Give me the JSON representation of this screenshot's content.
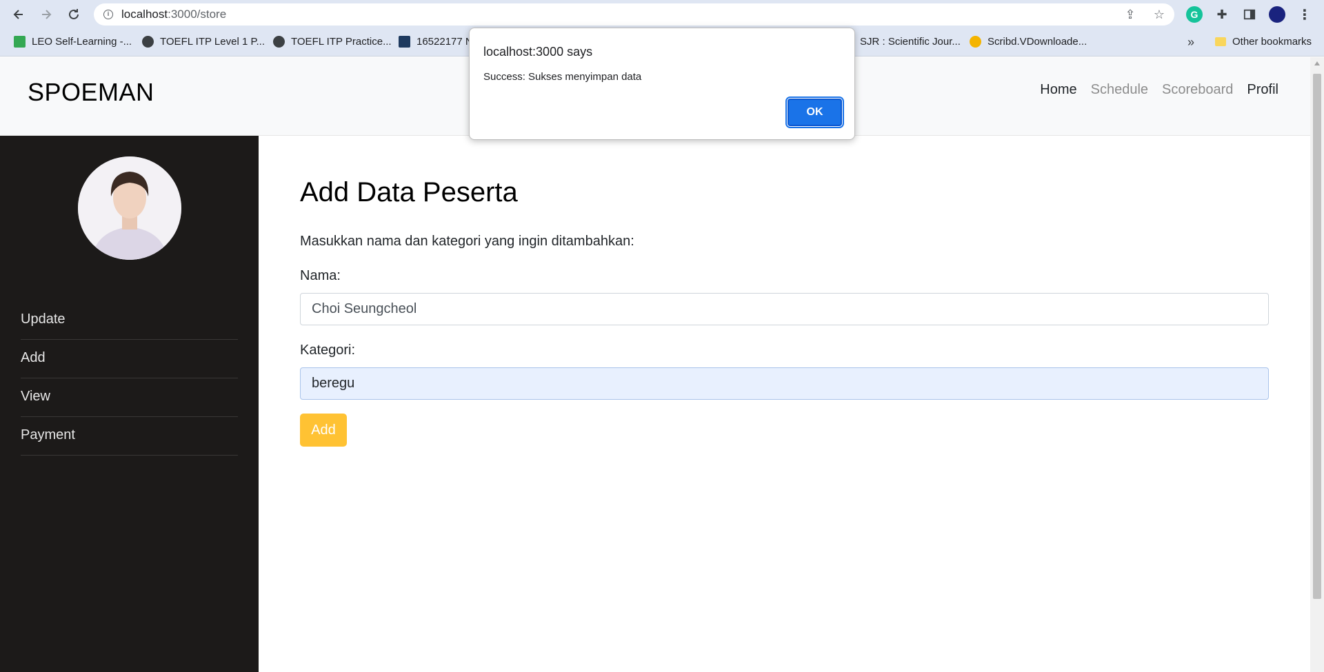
{
  "browser": {
    "url_host": "localhost",
    "url_path": ":3000/store",
    "bookmarks": [
      {
        "label": "LEO Self-Learning -...",
        "color": "#34a853"
      },
      {
        "label": "TOEFL ITP Level 1 P...",
        "color": "#3c4043"
      },
      {
        "label": "TOEFL ITP Practice...",
        "color": "#3c4043"
      },
      {
        "label": "16522177 N",
        "color": "#1e3a5f"
      },
      {
        "label": "SJR : Scientific Jour...",
        "color": "#9aa0a6"
      },
      {
        "label": "Scribd.VDownloade...",
        "color": "#f4b400"
      }
    ],
    "more_bookmarks": "»",
    "other_bookmarks": "Other bookmarks"
  },
  "navbar": {
    "brand": "SPOEMAN",
    "links": [
      {
        "label": "Home",
        "state": "active"
      },
      {
        "label": "Schedule",
        "state": "dim"
      },
      {
        "label": "Scoreboard",
        "state": "dim"
      },
      {
        "label": "Profil",
        "state": "active"
      }
    ]
  },
  "sidebar": {
    "items": [
      "Update",
      "Add",
      "View",
      "Payment"
    ]
  },
  "main": {
    "title": "Add Data Peserta",
    "description": "Masukkan nama dan kategori yang ingin ditambahkan:",
    "name_label": "Nama:",
    "name_value": "Choi Seungcheol",
    "category_label": "Kategori:",
    "category_value": "beregu",
    "add_label": "Add"
  },
  "dialog": {
    "title": "localhost:3000 says",
    "message": "Success: Sukses menyimpan data",
    "ok_label": "OK"
  },
  "colors": {
    "sidebar_bg": "#1c1a19",
    "accent_button": "#ffc233",
    "dialog_ok": "#1a73e8"
  }
}
